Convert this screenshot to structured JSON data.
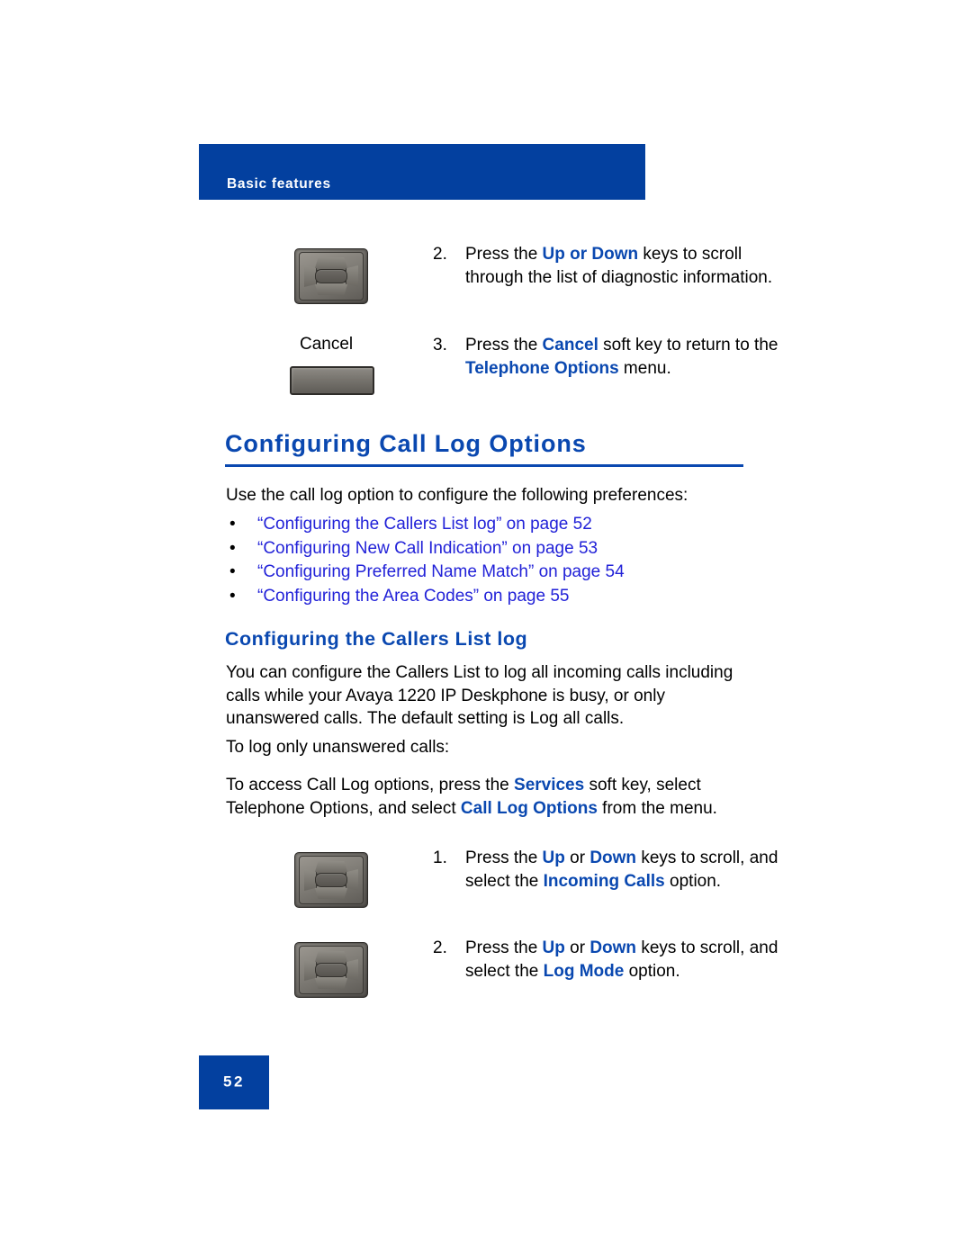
{
  "document": {
    "running_header": "Basic features",
    "page_number": "52",
    "accent_blue": "#03409f",
    "heading_blue": "#0a48b0",
    "link_blue": "#2222d8"
  },
  "top_steps": [
    {
      "number": "2.",
      "text_parts": [
        {
          "text": "Press the ",
          "style": "normal"
        },
        {
          "text": "Up or Down",
          "style": "bold-blue"
        },
        {
          "text": " keys to scroll through the list of diagnostic information.",
          "style": "normal"
        }
      ],
      "artwork": "navigation-keys-image"
    },
    {
      "number": "3.",
      "text_parts": [
        {
          "text": "Press the ",
          "style": "normal"
        },
        {
          "text": "Cancel",
          "style": "bold-blue"
        },
        {
          "text": " soft key to return to the ",
          "style": "normal"
        },
        {
          "text": "Telephone Options",
          "style": "bold-blue"
        },
        {
          "text": " menu.",
          "style": "normal"
        }
      ],
      "artwork": "soft-key-image",
      "artwork_label": "Cancel"
    }
  ],
  "section": {
    "title": "Configuring Call Log Options",
    "intro": "Use the call log option to configure the following preferences:",
    "links": [
      {
        "bullet": "•",
        "label": "“Configuring the Callers List log” on page 52"
      },
      {
        "bullet": "•",
        "label": "“Configuring New Call Indication” on page 53"
      },
      {
        "bullet": "•",
        "label": "“Configuring Preferred Name Match” on page 54"
      },
      {
        "bullet": "•",
        "label": "“Configuring the Area Codes” on page 55"
      }
    ]
  },
  "subsection": {
    "title": "Configuring the Callers List log",
    "paragraph_1": "You can configure the Callers List to log all incoming calls including calls while your Avaya 1220 IP Deskphone is busy,  or only unanswered calls. The default setting is Log all calls.",
    "paragraph_2": "To log only unanswered calls:",
    "paragraph_3_parts": [
      {
        "text": "To access Call Log options, press the ",
        "style": "normal"
      },
      {
        "text": "Services",
        "style": "bold-blue"
      },
      {
        "text": " soft key, select Telephone Options, and select ",
        "style": "normal"
      },
      {
        "text": "Call Log Options",
        "style": "bold-blue"
      },
      {
        "text": " from the menu.",
        "style": "normal"
      }
    ]
  },
  "bottom_steps": [
    {
      "number": "1.",
      "text_parts": [
        {
          "text": "Press the ",
          "style": "normal"
        },
        {
          "text": "Up",
          "style": "bold-blue"
        },
        {
          "text": " or ",
          "style": "normal"
        },
        {
          "text": "Down",
          "style": "bold-blue"
        },
        {
          "text": " keys to scroll, and select the ",
          "style": "normal"
        },
        {
          "text": "Incoming Calls",
          "style": "bold-blue"
        },
        {
          "text": " option.",
          "style": "normal"
        }
      ],
      "artwork": "navigation-keys-image"
    },
    {
      "number": "2.",
      "text_parts": [
        {
          "text": "Press the ",
          "style": "normal"
        },
        {
          "text": "Up",
          "style": "bold-blue"
        },
        {
          "text": " or ",
          "style": "normal"
        },
        {
          "text": "Down",
          "style": "bold-blue"
        },
        {
          "text": " keys to scroll, and select the ",
          "style": "normal"
        },
        {
          "text": "Log Mode",
          "style": "bold-blue"
        },
        {
          "text": " option.",
          "style": "normal"
        }
      ],
      "artwork": "navigation-keys-image"
    }
  ]
}
